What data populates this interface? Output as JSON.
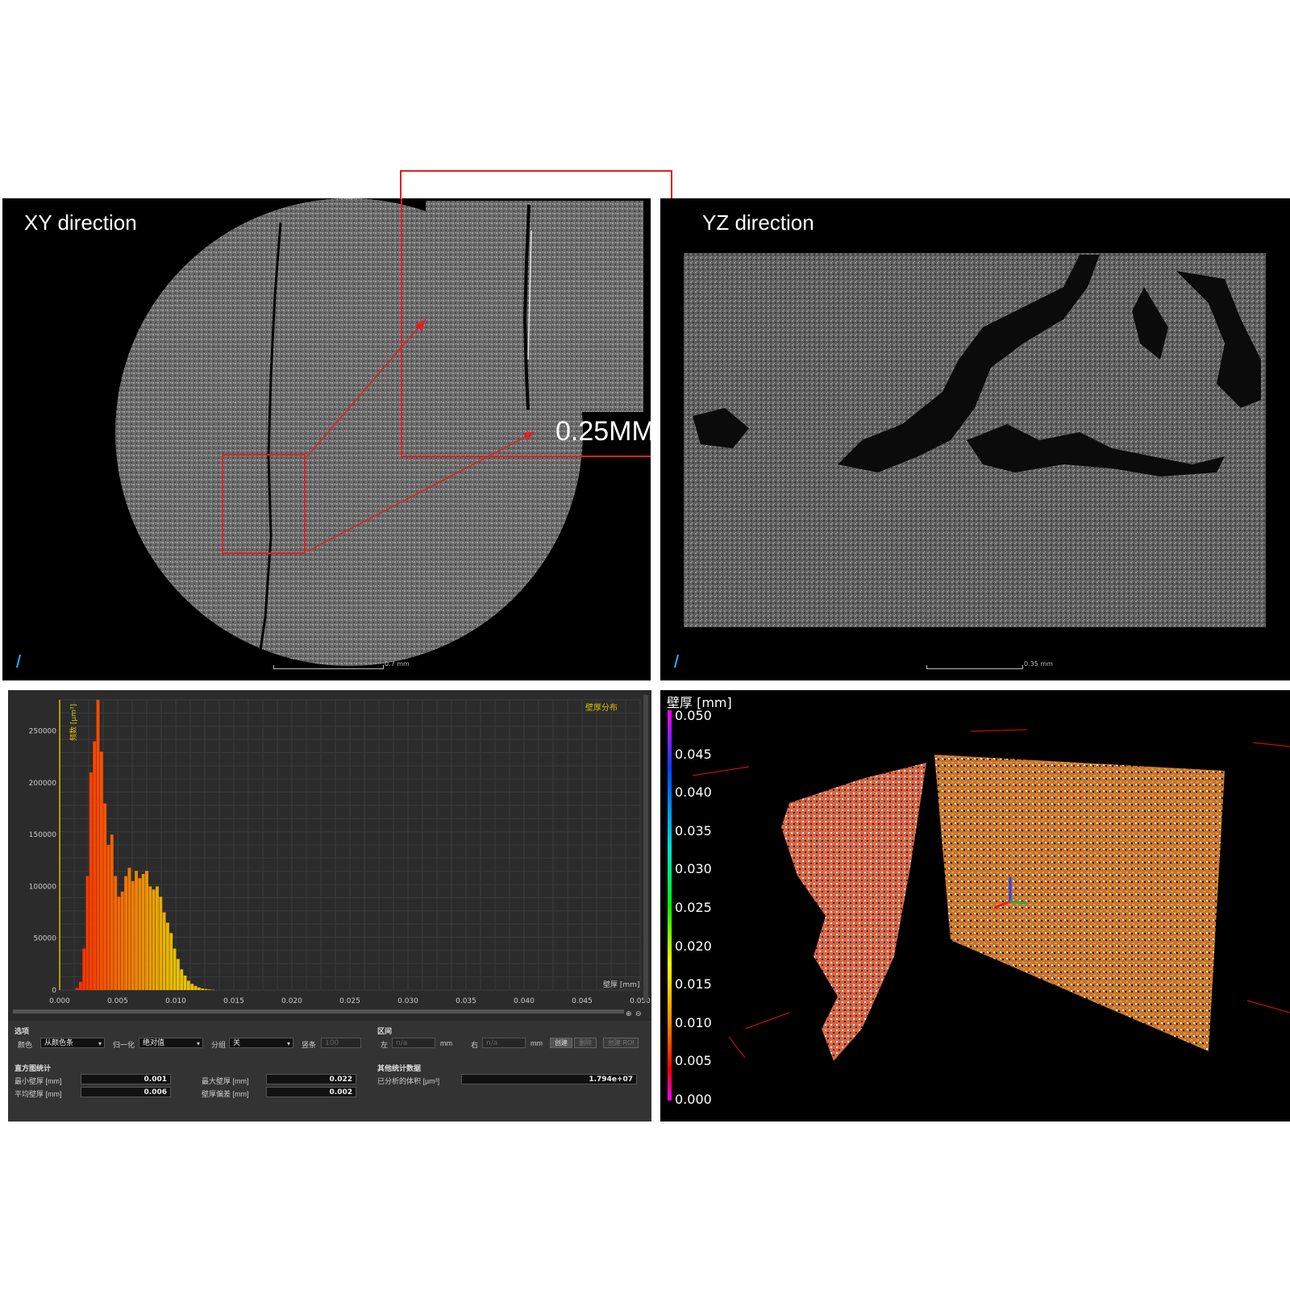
{
  "panels": {
    "xy": {
      "title": "XY direction",
      "scale_label": "0.7 mm",
      "zoom_label": "0.25MM"
    },
    "yz": {
      "title": "YZ direction",
      "scale_label": "0.35 mm"
    }
  },
  "histogram": {
    "ylabel": "频数 [µm³]",
    "legend": "壁厚分布",
    "xlabel": "壁厚 [mm]"
  },
  "chart_data": {
    "type": "bar",
    "title": "",
    "legend": [
      "壁厚分布"
    ],
    "xlabel": "壁厚 [mm]",
    "ylabel": "频数 [µm³]",
    "xlim": [
      0,
      0.05
    ],
    "ylim": [
      0,
      280000
    ],
    "xticks": [
      "0.000",
      "0.005",
      "0.010",
      "0.015",
      "0.020",
      "0.025",
      "0.030",
      "0.035",
      "0.040",
      "0.045",
      "0.050"
    ],
    "yticks": [
      "0",
      "50000",
      "100000",
      "150000",
      "200000",
      "250000"
    ],
    "grid": true,
    "x": [
      0.0015,
      0.0018,
      0.0021,
      0.0024,
      0.0027,
      0.003,
      0.0033,
      0.0036,
      0.0039,
      0.0042,
      0.0045,
      0.0048,
      0.0051,
      0.0054,
      0.0057,
      0.006,
      0.0063,
      0.0066,
      0.0069,
      0.0072,
      0.0075,
      0.0078,
      0.0081,
      0.0084,
      0.0087,
      0.009,
      0.0093,
      0.0096,
      0.0099,
      0.0102,
      0.0105,
      0.0108,
      0.0111,
      0.0114,
      0.0117,
      0.012,
      0.0123,
      0.0126,
      0.0129,
      0.0132
    ],
    "values": [
      2000,
      8000,
      40000,
      110000,
      210000,
      240000,
      280000,
      230000,
      180000,
      140000,
      150000,
      110000,
      90000,
      95000,
      110000,
      118000,
      105000,
      115000,
      108000,
      112000,
      115000,
      100000,
      97000,
      100000,
      90000,
      75000,
      65000,
      55000,
      40000,
      30000,
      20000,
      14000,
      9000,
      6000,
      4000,
      2500,
      1500,
      1000,
      600,
      300
    ]
  },
  "controls": {
    "options": {
      "section": "选项",
      "color_label": "颜色",
      "color_value": "从颜色条",
      "normalize_label": "归一化",
      "normalize_value": "绝对值",
      "group_label": "分组",
      "group_value": "关",
      "bars_label": "竖条",
      "bars_value": "100"
    },
    "range": {
      "section": "区间",
      "left_label": "左",
      "left_value": "n/a",
      "left_unit": "mm",
      "right_label": "右",
      "right_value": "n/a",
      "right_unit": "mm",
      "create_btn": "创建",
      "delete_btn": "删除",
      "roi_btn": "创建 ROI"
    },
    "stats": {
      "section": "直方图统计",
      "min_label": "最小壁厚 [mm]",
      "min_value": "0.001",
      "max_label": "最大壁厚 [mm]",
      "max_value": "0.022",
      "mean_label": "平均壁厚 [mm]",
      "mean_value": "0.006",
      "std_label": "壁厚偏差 [mm]",
      "std_value": "0.002"
    },
    "other": {
      "section": "其他统计数据",
      "volume_label": "已分析的体积 [µm³]",
      "volume_value": "1.794e+07"
    }
  },
  "volume": {
    "colorbar_title": "壁厚 [mm]",
    "colorbar_ticks": [
      "0.050",
      "0.045",
      "0.040",
      "0.035",
      "0.030",
      "0.025",
      "0.020",
      "0.015",
      "0.010",
      "0.005",
      "0.000"
    ]
  },
  "colors": {
    "highlight": "#e02020",
    "bar_low": "#ff2a00",
    "bar_high": "#e6c000",
    "axis": "#d7c000"
  }
}
